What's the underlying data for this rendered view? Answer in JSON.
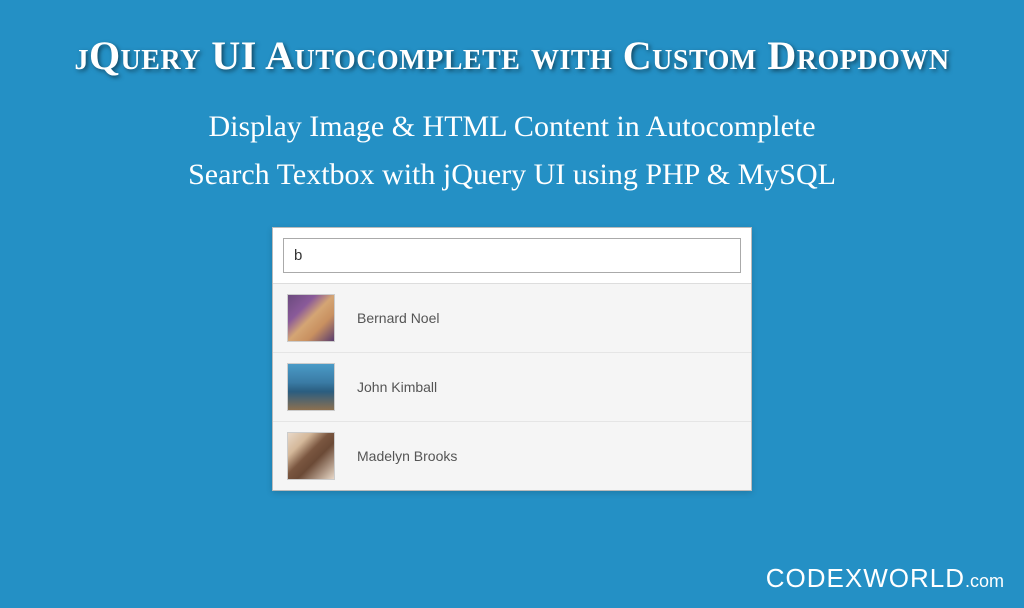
{
  "title": "jQuery UI Autocomplete with Custom Dropdown",
  "subtitle_line1": "Display Image & HTML Content in Autocomplete",
  "subtitle_line2": "Search Textbox with jQuery UI using PHP & MySQL",
  "search": {
    "value": "b"
  },
  "results": [
    {
      "name": "Bernard Noel"
    },
    {
      "name": "John Kimball"
    },
    {
      "name": "Madelyn Brooks"
    }
  ],
  "brand": {
    "main": "CODEXWORLD",
    "suffix": ".com"
  }
}
